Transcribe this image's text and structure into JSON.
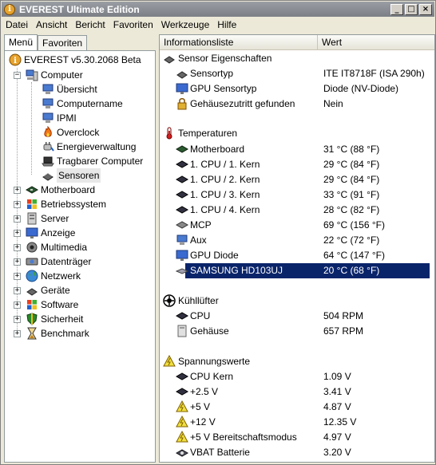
{
  "window": {
    "title": "EVEREST Ultimate Edition",
    "min": "_",
    "max": "□",
    "close": "×"
  },
  "menubar": [
    "Datei",
    "Ansicht",
    "Bericht",
    "Favoriten",
    "Werkzeuge",
    "Hilfe"
  ],
  "tabs": {
    "menu": "Menü",
    "favorites": "Favoriten"
  },
  "tree": {
    "root": "EVEREST v5.30.2068 Beta",
    "computer": "Computer",
    "computer_children": [
      "Übersicht",
      "Computername",
      "IPMI",
      "Overclock",
      "Energieverwaltung",
      "Tragbarer Computer",
      "Sensoren"
    ],
    "top_level": [
      "Motherboard",
      "Betriebssystem",
      "Server",
      "Anzeige",
      "Multimedia",
      "Datenträger",
      "Netzwerk",
      "Geräte",
      "Software",
      "Sicherheit",
      "Benchmark"
    ]
  },
  "columns": {
    "field": "Informationsliste",
    "value": "Wert"
  },
  "sections": {
    "sensor": {
      "header": "Sensor Eigenschaften",
      "rows": [
        {
          "label": "Sensortyp",
          "value": "ITE IT8718F  (ISA 290h)"
        },
        {
          "label": "GPU Sensortyp",
          "value": "Diode  (NV-Diode)"
        },
        {
          "label": "Gehäusezutritt gefunden",
          "value": "Nein"
        }
      ]
    },
    "temps": {
      "header": "Temperaturen",
      "rows": [
        {
          "label": "Motherboard",
          "value": "31 °C  (88 °F)"
        },
        {
          "label": "1. CPU / 1. Kern",
          "value": "29 °C  (84 °F)"
        },
        {
          "label": "1. CPU / 2. Kern",
          "value": "29 °C  (84 °F)"
        },
        {
          "label": "1. CPU / 3. Kern",
          "value": "33 °C  (91 °F)"
        },
        {
          "label": "1. CPU / 4. Kern",
          "value": "28 °C  (82 °F)"
        },
        {
          "label": "MCP",
          "value": "69 °C  (156 °F)"
        },
        {
          "label": "Aux",
          "value": "22 °C  (72 °F)"
        },
        {
          "label": "GPU Diode",
          "value": "64 °C  (147 °F)"
        },
        {
          "label": "SAMSUNG HD103UJ",
          "value": "20 °C  (68 °F)"
        }
      ]
    },
    "fans": {
      "header": "Kühllüfter",
      "rows": [
        {
          "label": "CPU",
          "value": "504 RPM"
        },
        {
          "label": "Gehäuse",
          "value": "657 RPM"
        }
      ]
    },
    "volts": {
      "header": "Spannungswerte",
      "rows": [
        {
          "label": "CPU Kern",
          "value": "1.09 V"
        },
        {
          "label": "+2.5 V",
          "value": "3.41 V"
        },
        {
          "label": "+5 V",
          "value": "4.87 V"
        },
        {
          "label": "+12 V",
          "value": "12.35 V"
        },
        {
          "label": "+5 V Bereitschaftsmodus",
          "value": "4.97 V"
        },
        {
          "label": "VBAT Batterie",
          "value": "3.20 V"
        }
      ]
    }
  }
}
